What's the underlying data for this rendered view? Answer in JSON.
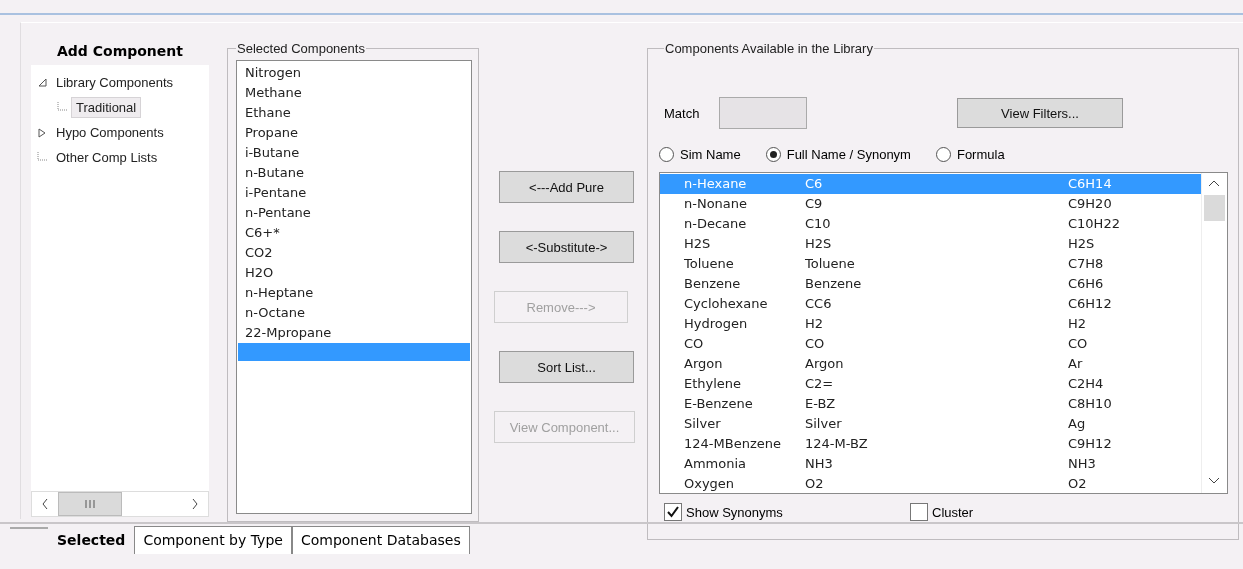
{
  "title": "Add Component",
  "tree": [
    {
      "label": "Library Components",
      "expanded": true,
      "selected": false,
      "children": [
        {
          "label": "Traditional",
          "selected": true
        }
      ]
    },
    {
      "label": "Hypo Components",
      "expanded": false,
      "selected": false
    },
    {
      "label": "Other Comp Lists",
      "selected": false
    }
  ],
  "selected_components": {
    "label": "Selected Components",
    "new_row_selected": true,
    "items": [
      {
        "label": "Nitrogen",
        "selected": false
      },
      {
        "label": "Methane",
        "selected": false
      },
      {
        "label": "Ethane",
        "selected": false
      },
      {
        "label": "Propane",
        "selected": false
      },
      {
        "label": "i-Butane",
        "selected": false
      },
      {
        "label": "n-Butane",
        "selected": false
      },
      {
        "label": "i-Pentane",
        "selected": false
      },
      {
        "label": "n-Pentane",
        "selected": false
      },
      {
        "label": "C6+*",
        "selected": false
      },
      {
        "label": "CO2",
        "selected": false
      },
      {
        "label": "H2O",
        "selected": false
      },
      {
        "label": "n-Heptane",
        "selected": false
      },
      {
        "label": "n-Octane",
        "selected": false
      },
      {
        "label": "22-Mpropane",
        "selected": false
      }
    ]
  },
  "actions": [
    {
      "label": "<---Add Pure",
      "disabled": false
    },
    {
      "label": "<-Substitute->",
      "disabled": false
    },
    {
      "label": "Remove--->",
      "disabled": true
    },
    {
      "label": "Sort List...",
      "disabled": false
    },
    {
      "label": "View Component...",
      "disabled": true
    }
  ],
  "library": {
    "label": "Components Available in the Library",
    "match_label": "Match",
    "view_filters": "View Filters...",
    "name_modes": [
      {
        "label": "Sim Name",
        "selected": false
      },
      {
        "label": "Full Name / Synonym",
        "selected": true
      },
      {
        "label": "Formula",
        "selected": false
      }
    ],
    "rows": [
      {
        "name": "n-Hexane",
        "synonym": "C6",
        "formula": "C6H14",
        "selected": true
      },
      {
        "name": "n-Nonane",
        "synonym": "C9",
        "formula": "C9H20",
        "selected": false
      },
      {
        "name": "n-Decane",
        "synonym": "C10",
        "formula": "C10H22",
        "selected": false
      },
      {
        "name": "H2S",
        "synonym": "H2S",
        "formula": "H2S",
        "selected": false
      },
      {
        "name": "Toluene",
        "synonym": "Toluene",
        "formula": "C7H8",
        "selected": false
      },
      {
        "name": "Benzene",
        "synonym": "Benzene",
        "formula": "C6H6",
        "selected": false
      },
      {
        "name": "Cyclohexane",
        "synonym": "CC6",
        "formula": "C6H12",
        "selected": false
      },
      {
        "name": "Hydrogen",
        "synonym": "H2",
        "formula": "H2",
        "selected": false
      },
      {
        "name": "CO",
        "synonym": "CO",
        "formula": "CO",
        "selected": false
      },
      {
        "name": "Argon",
        "synonym": "Argon",
        "formula": "Ar",
        "selected": false
      },
      {
        "name": "Ethylene",
        "synonym": "C2=",
        "formula": "C2H4",
        "selected": false
      },
      {
        "name": "E-Benzene",
        "synonym": "E-BZ",
        "formula": "C8H10",
        "selected": false
      },
      {
        "name": "Silver",
        "synonym": "Silver",
        "formula": "Ag",
        "selected": false
      },
      {
        "name": "124-MBenzene",
        "synonym": "124-M-BZ",
        "formula": "C9H12",
        "selected": false
      },
      {
        "name": "Ammonia",
        "synonym": "NH3",
        "formula": "NH3",
        "selected": false
      },
      {
        "name": "Oxygen",
        "synonym": "O2",
        "formula": "O2",
        "selected": false
      }
    ],
    "options": [
      {
        "label": "Show Synonyms",
        "checked": true
      },
      {
        "label": "Cluster",
        "checked": false
      }
    ]
  },
  "tabs": [
    {
      "label": "Selected",
      "selected": true
    },
    {
      "label": "Component by Type",
      "selected": false
    },
    {
      "label": "Component Databases",
      "selected": false
    }
  ]
}
